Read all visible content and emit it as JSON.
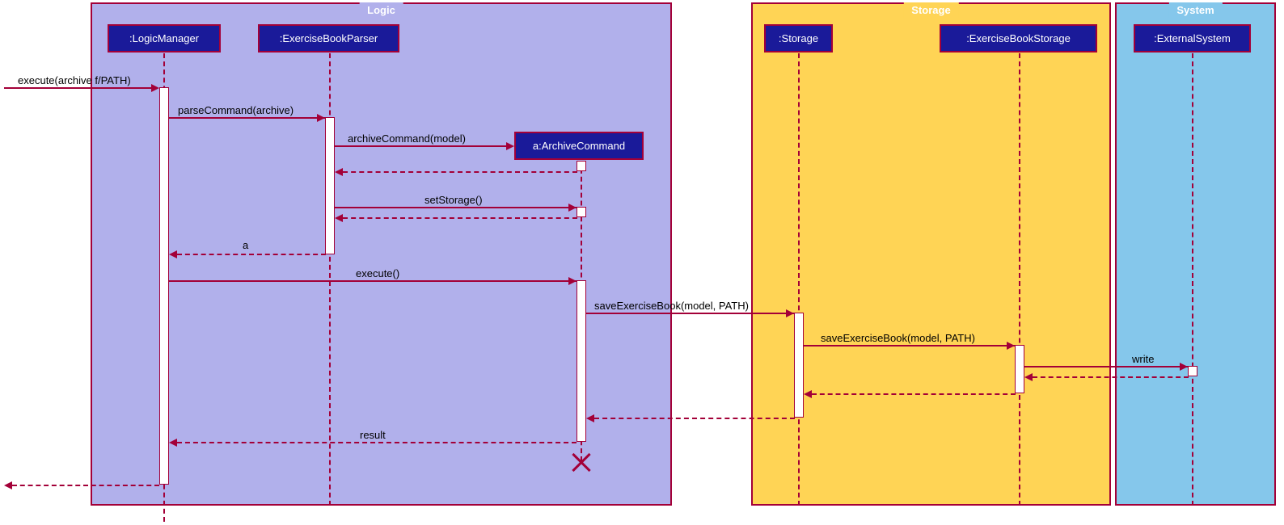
{
  "boxes": {
    "logic": {
      "label": "Logic"
    },
    "storage": {
      "label": "Storage"
    },
    "system": {
      "label": "System"
    }
  },
  "participants": {
    "logicManager": ":LogicManager",
    "exerciseBookParser": ":ExerciseBookParser",
    "archiveCommand": "a:ArchiveCommand",
    "storage": ":Storage",
    "exerciseBookStorage": ":ExerciseBookStorage",
    "externalSystem": ":ExternalSystem"
  },
  "messages": {
    "m1": "execute(archive f/PATH)",
    "m2": "parseCommand(archive)",
    "m3": "archiveCommand(model)",
    "r3": "",
    "m4": "setStorage()",
    "r4": "",
    "r5": "a",
    "m6": "execute()",
    "m7": "saveExerciseBook(model, PATH)",
    "m8": "saveExerciseBook(model, PATH)",
    "m9": "write",
    "r10": "result"
  }
}
